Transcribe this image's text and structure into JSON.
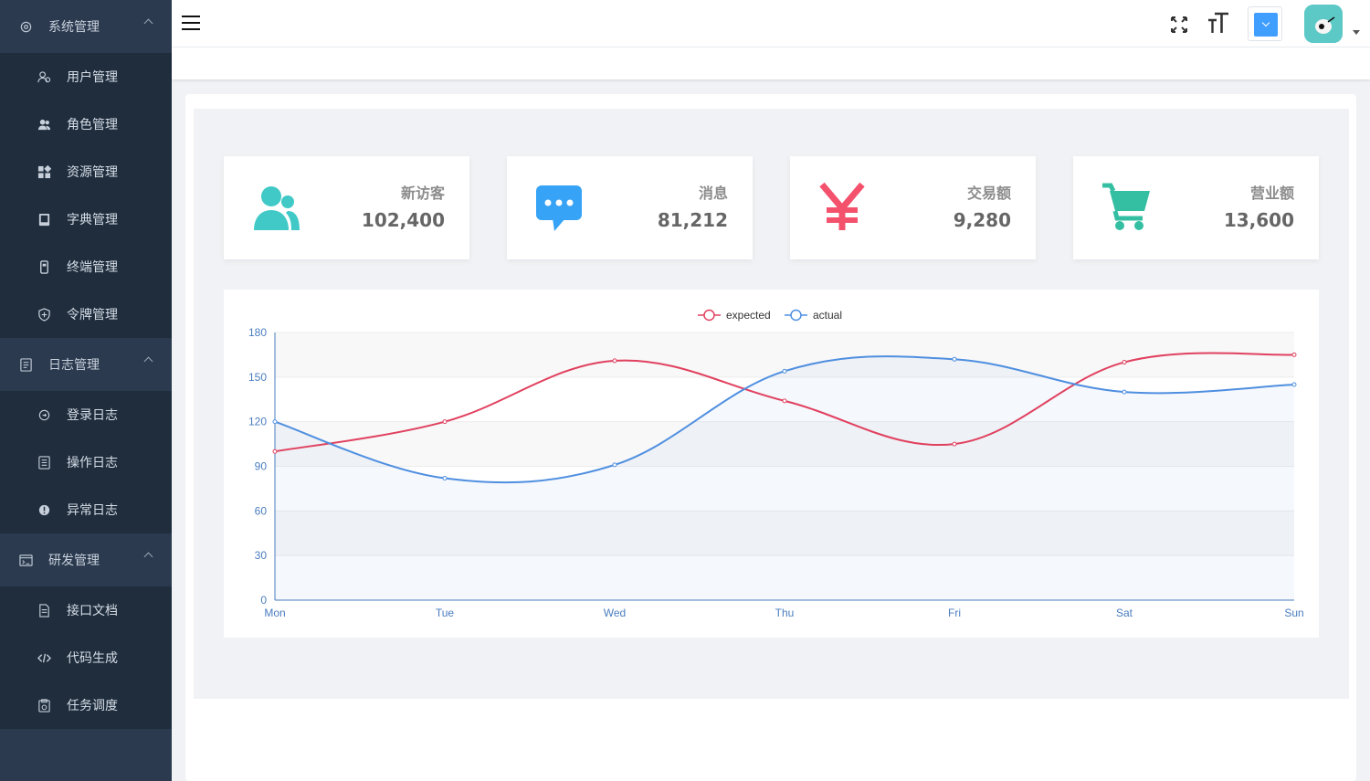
{
  "sidebar": {
    "groups": [
      {
        "title": "系统管理",
        "items": [
          {
            "label": "用户管理"
          },
          {
            "label": "角色管理"
          },
          {
            "label": "资源管理"
          },
          {
            "label": "字典管理"
          },
          {
            "label": "终端管理"
          },
          {
            "label": "令牌管理"
          }
        ]
      },
      {
        "title": "日志管理",
        "items": [
          {
            "label": "登录日志"
          },
          {
            "label": "操作日志"
          },
          {
            "label": "异常日志"
          }
        ]
      },
      {
        "title": "研发管理",
        "items": [
          {
            "label": "接口文档"
          },
          {
            "label": "代码生成"
          },
          {
            "label": "任务调度"
          }
        ]
      }
    ]
  },
  "header": {
    "font_size_glyph": "T",
    "size_select_color": "#409eff"
  },
  "stats": [
    {
      "label": "新访客",
      "value": "102,400",
      "color": "#40c9c6"
    },
    {
      "label": "消息",
      "value": "81,212",
      "color": "#36a3f7"
    },
    {
      "label": "交易额",
      "value": "9,280",
      "color": "#f4516c"
    },
    {
      "label": "营业额",
      "value": "13,600",
      "color": "#34bfa3"
    }
  ],
  "chart_data": {
    "type": "line",
    "categories": [
      "Mon",
      "Tue",
      "Wed",
      "Thu",
      "Fri",
      "Sat",
      "Sun"
    ],
    "series": [
      {
        "name": "expected",
        "values": [
          100,
          120,
          161,
          134,
          105,
          160,
          165
        ],
        "color": "#e0415f"
      },
      {
        "name": "actual",
        "values": [
          120,
          82,
          91,
          154,
          162,
          140,
          145
        ],
        "color": "#4f8fe0"
      }
    ],
    "ylim": [
      0,
      180
    ],
    "yticks": [
      0,
      30,
      60,
      90,
      120,
      150,
      180
    ],
    "legend": "top-center",
    "smooth": true,
    "area_series": "actual"
  }
}
